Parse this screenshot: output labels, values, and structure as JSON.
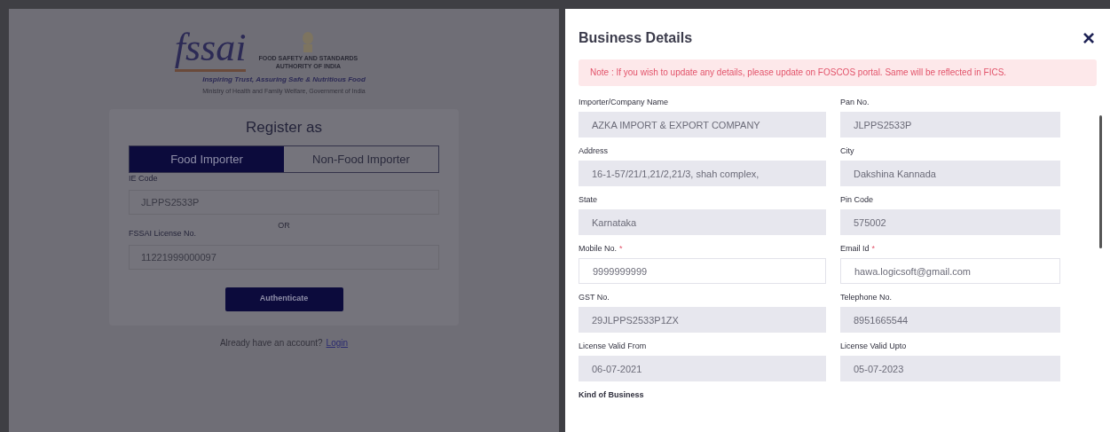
{
  "brand": {
    "logo": "fssai",
    "org": [
      "FOOD SAFETY AND STANDARDS",
      "AUTHORITY OF INDIA"
    ],
    "tagline": "Inspiring Trust, Assuring Safe & Nutritious Food",
    "ministry": "Ministry of Health and Family Welfare, Government of India"
  },
  "register": {
    "title": "Register as",
    "tabs": [
      {
        "label": "Food Importer",
        "selected": true
      },
      {
        "label": "Non-Food Importer",
        "selected": false
      }
    ],
    "fields": [
      {
        "label": "IE Code",
        "value": "JLPPS2533P"
      },
      {
        "label": "FSSAI License No.",
        "value": "11221999000097"
      }
    ],
    "separator": "OR",
    "button": "Authenticate",
    "footer": "Already have an account?",
    "link": "Login"
  },
  "panel": {
    "title": "Business Details",
    "close": "×",
    "note": "Note : If you wish to update any details, please update on FOSCOS portal. Same will be reflected in FICS.",
    "fields": [
      {
        "label": "Importer/Company Name",
        "value": "AZKA IMPORT & EXPORT COMPANY",
        "disabled": true
      },
      {
        "label": "Pan No.",
        "value": "JLPPS2533P",
        "disabled": true
      },
      {
        "label": "Address",
        "value": "16-1-57/21/1,21/2,21/3, shah complex,",
        "disabled": true
      },
      {
        "label": "City",
        "value": "Dakshina Kannada",
        "disabled": true
      },
      {
        "label": "State",
        "value": "Karnataka",
        "disabled": true
      },
      {
        "label": "Pin Code",
        "value": "575002",
        "disabled": true
      },
      {
        "label": "Mobile No.",
        "value": "9999999999",
        "disabled": false,
        "required_mark": "*"
      },
      {
        "label": "Email Id",
        "value": "hawa.logicsoft@gmail.com",
        "disabled": false,
        "required_mark": "*"
      },
      {
        "label": "GST No.",
        "value": "29JLPPS2533P1ZX",
        "disabled": true
      },
      {
        "label": "Telephone No.",
        "value": "8951665544",
        "disabled": true
      },
      {
        "label": "License Valid From",
        "value": "06-07-2021",
        "disabled": true
      },
      {
        "label": "License Valid Upto",
        "value": "05-07-2023",
        "disabled": true
      }
    ],
    "next_label": "Kind of Business"
  }
}
